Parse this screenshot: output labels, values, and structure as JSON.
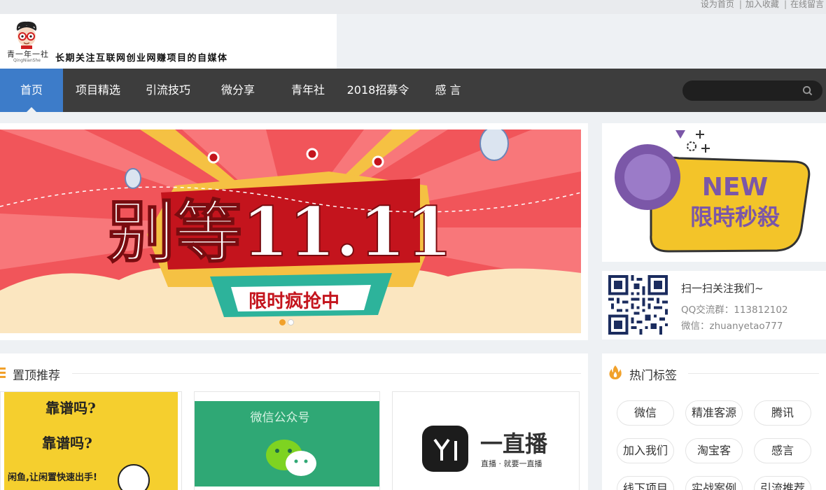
{
  "topbar": {
    "links": [
      "设为首页",
      "加入收藏",
      "在线留言"
    ]
  },
  "header": {
    "brand": "青一年一社",
    "brand_sub": "QingNianShe",
    "slogan": "长期关注互联网创业网赚项目的自媒体"
  },
  "nav": {
    "items": [
      "首页",
      "项目精选",
      "引流技巧",
      "微分享",
      "青年社",
      "2018招募令",
      "感 言"
    ],
    "active_index": 0,
    "search_placeholder": ""
  },
  "banner": {
    "headline": "别等11.11",
    "subline": "限时疯抢中",
    "slide_count": 2,
    "active_slide": 0
  },
  "promo": {
    "line1": "NEW",
    "line2": "限時秒殺"
  },
  "follow": {
    "title": "扫一扫关注我们~",
    "qq": "QQ交流群：113812102",
    "wechat": "微信：zhuanyetao777"
  },
  "featured": {
    "title": "置顶推荐",
    "cards": [
      {
        "img_text": "闲鱼,让闲置快速出手!",
        "img_text2": "靠谱吗?"
      },
      {
        "img_text": "微信公众号"
      },
      {
        "img_text": "一直播",
        "img_text2": "直播 · 就要一直播"
      }
    ]
  },
  "tags": {
    "title": "热门标签",
    "items": [
      "微信",
      "精准客源",
      "腾讯",
      "加入我们",
      "淘宝客",
      "感言",
      "线下项目",
      "实战案例",
      "引流推荐"
    ]
  },
  "colors": {
    "nav_bg": "#3d3d3d",
    "nav_active": "#3d7cc9",
    "accent_orange": "#f1a12b",
    "page_bg": "#eef1f4"
  }
}
